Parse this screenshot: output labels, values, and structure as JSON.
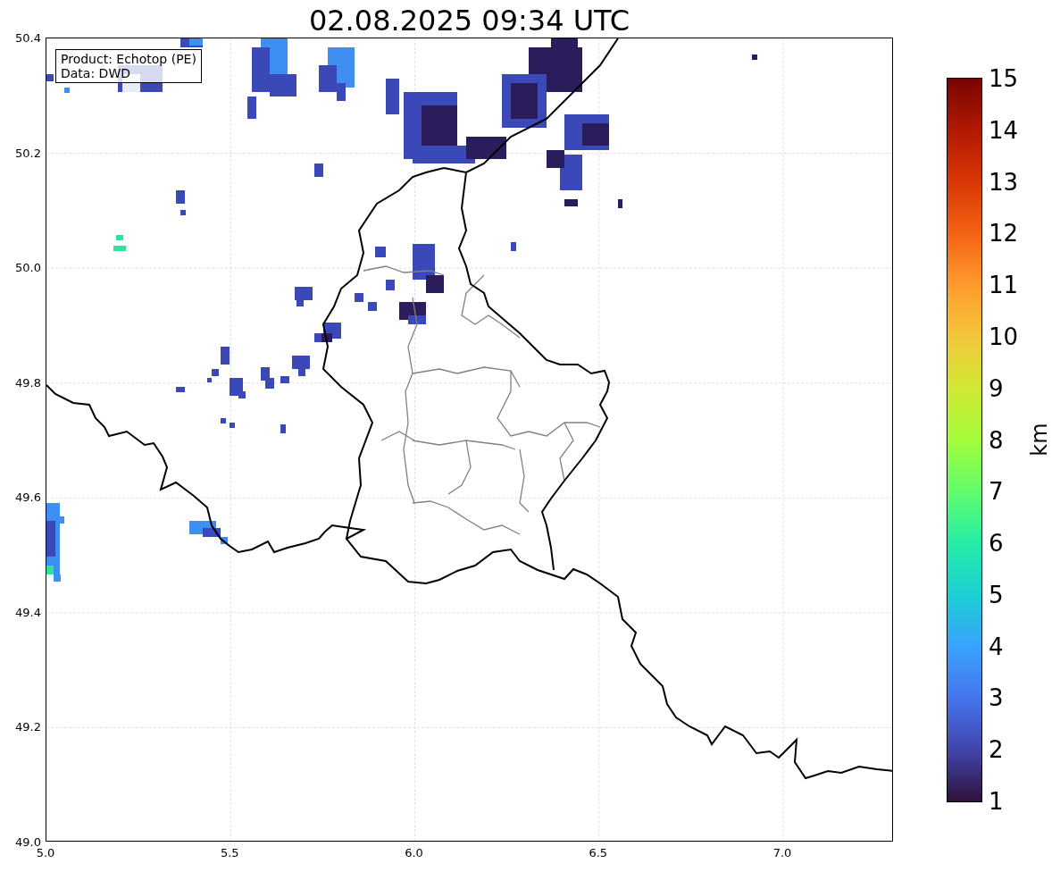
{
  "title": "02.08.2025 09:34 UTC",
  "legend": [
    "Product: Echotop (PE)",
    "Data: DWD"
  ],
  "x_ticks": [
    "5.0",
    "5.5",
    "6.0",
    "6.5",
    "7.0"
  ],
  "y_ticks": [
    "50.4",
    "50.2",
    "50.0",
    "49.8",
    "49.6",
    "49.4",
    "49.2",
    "49.0"
  ],
  "colorbar": {
    "label": "km",
    "ticks": [
      "15",
      "14",
      "13",
      "12",
      "11",
      "10",
      "9",
      "8",
      "7",
      "6",
      "5",
      "4",
      "3",
      "2",
      "1"
    ]
  }
}
